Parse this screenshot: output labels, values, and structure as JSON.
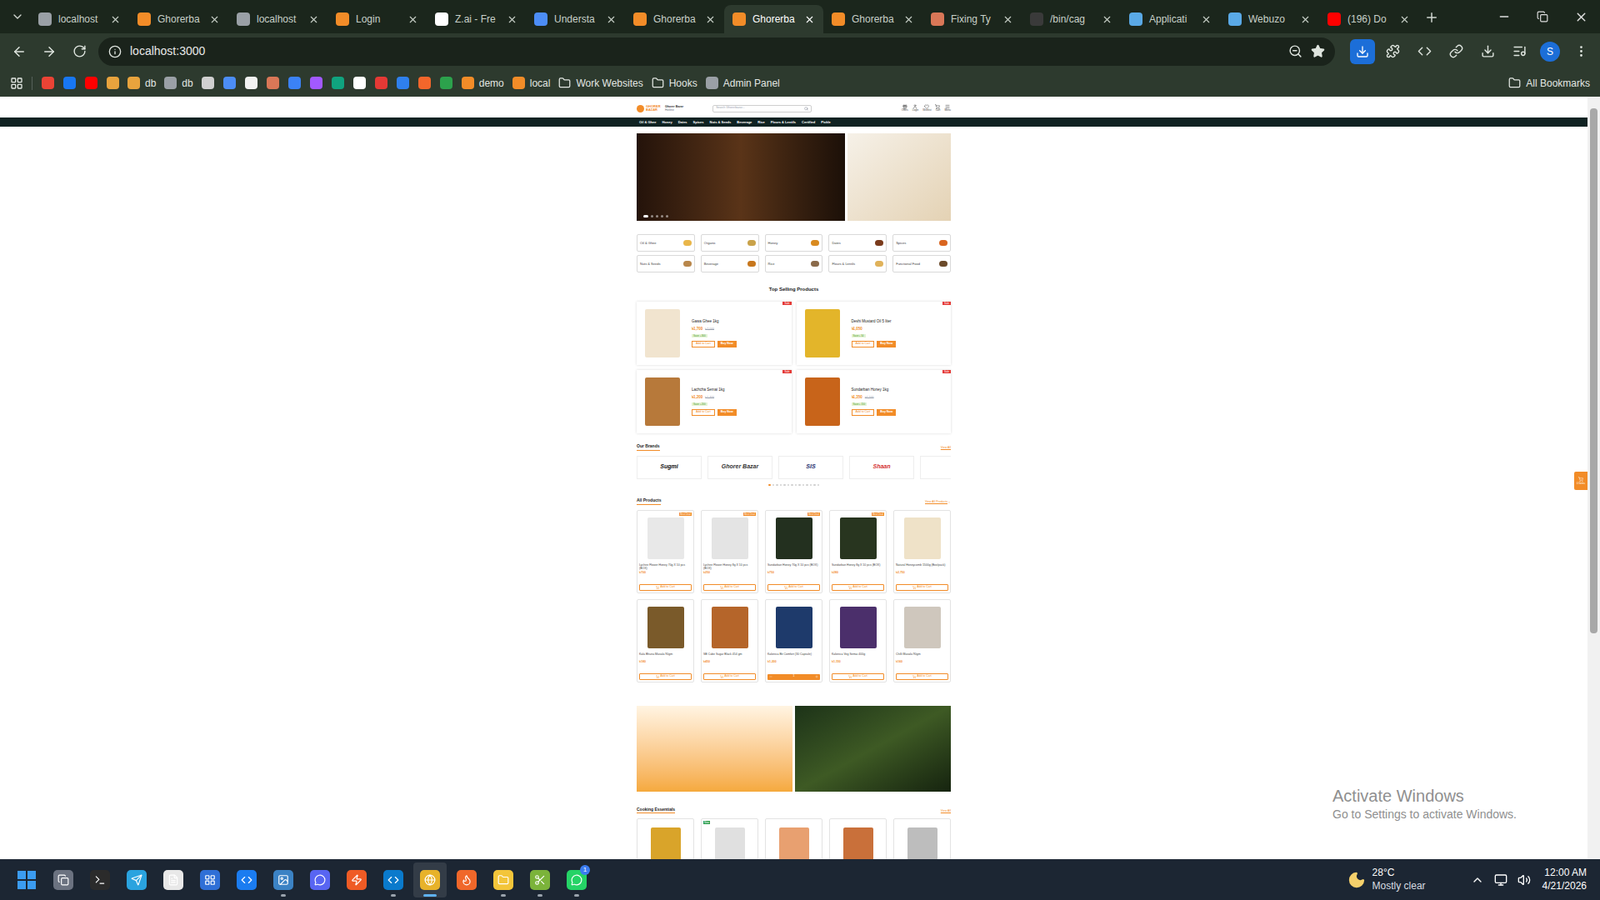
{
  "browser": {
    "tabs": [
      {
        "label": "localhost",
        "selected": false,
        "color": "#9aa0a6"
      },
      {
        "label": "Ghorerba",
        "selected": false,
        "color": "#f28c28"
      },
      {
        "label": "localhost",
        "selected": false,
        "color": "#9aa0a6"
      },
      {
        "label": "Login",
        "selected": false,
        "color": "#f28c28"
      },
      {
        "label": "Z.ai - Fre",
        "selected": false,
        "color": "#ffffff"
      },
      {
        "label": "Understa",
        "selected": false,
        "color": "#4c8df6"
      },
      {
        "label": "Ghorerba",
        "selected": false,
        "color": "#f28c28"
      },
      {
        "label": "Ghorerba",
        "selected": true,
        "color": "#f28c28"
      },
      {
        "label": "Ghorerba",
        "selected": false,
        "color": "#f28c28"
      },
      {
        "label": "Fixing Ty",
        "selected": false,
        "color": "#d97757"
      },
      {
        "label": "/bin/cag",
        "selected": false,
        "color": "#3a3a3a"
      },
      {
        "label": "Applicati",
        "selected": false,
        "color": "#5aa9e6"
      },
      {
        "label": "Webuzo",
        "selected": false,
        "color": "#5aa9e6"
      },
      {
        "label": "(196) Do",
        "selected": false,
        "color": "#ff0000"
      }
    ],
    "address": "localhost:3000",
    "profile": "S",
    "bookmarks": [
      {
        "kind": "icon",
        "color": "#ea4335"
      },
      {
        "kind": "icon",
        "color": "#1877f2"
      },
      {
        "kind": "icon",
        "color": "#ff0000"
      },
      {
        "kind": "icon",
        "color": "#e8a33d"
      },
      {
        "kind": "site",
        "label": "db",
        "color": "#e8a33d"
      },
      {
        "kind": "site",
        "label": "db",
        "color": "#9aa0a6"
      },
      {
        "kind": "icon",
        "color": "#d0d0d0"
      },
      {
        "kind": "icon",
        "color": "#4c8df6"
      },
      {
        "kind": "icon",
        "color": "#f2f2f2"
      },
      {
        "kind": "icon",
        "color": "#d97757"
      },
      {
        "kind": "icon",
        "color": "#3b82f6"
      },
      {
        "kind": "icon",
        "color": "#a259ff"
      },
      {
        "kind": "icon",
        "color": "#10a37f"
      },
      {
        "kind": "icon",
        "color": "#ffffff"
      },
      {
        "kind": "icon",
        "color": "#e53935"
      },
      {
        "kind": "icon",
        "color": "#2f80ed"
      },
      {
        "kind": "icon",
        "color": "#f2662b"
      },
      {
        "kind": "icon",
        "color": "#2ca24c"
      },
      {
        "kind": "site",
        "label": "demo",
        "color": "#f28c28"
      },
      {
        "kind": "site",
        "label": "local",
        "color": "#f28c28"
      },
      {
        "kind": "folder",
        "label": "Work Websites"
      },
      {
        "kind": "folder",
        "label": "Hooks"
      },
      {
        "kind": "site",
        "label": "Admin Panel",
        "color": "#9aa0a6"
      }
    ],
    "all_bookmarks": "All Bookmarks"
  },
  "site": {
    "logo": "GHORER BAZAR",
    "store_name": "Ghorer Bazar",
    "store_sub": "Hotline",
    "search_placeholder": "Search Ghorerbazar...",
    "header_links": [
      "Offers",
      "Login",
      "Wishlist",
      "Cart",
      "Menu"
    ],
    "nav": [
      "Oil & Ghee",
      "Honey",
      "Dates",
      "Spices",
      "Nuts & Seeds",
      "Beverage",
      "Rice",
      "Flours & Lentils",
      "Certified",
      "Pickle"
    ],
    "hero_dots": [
      {
        "selected": true
      },
      {
        "selected": false
      },
      {
        "selected": false
      },
      {
        "selected": false
      },
      {
        "selected": false
      }
    ],
    "categories": [
      {
        "label": "Oil & Ghee",
        "color": "#e9b64a"
      },
      {
        "label": "Organic",
        "color": "#c9a24a"
      },
      {
        "label": "Honey",
        "color": "#d98a1f"
      },
      {
        "label": "Dates",
        "color": "#7a3b1c"
      },
      {
        "label": "Spices",
        "color": "#d9651f"
      },
      {
        "label": "Nuts & Seeds",
        "color": "#b8864a"
      },
      {
        "label": "Beverage",
        "color": "#c7771d"
      },
      {
        "label": "Rice",
        "color": "#8a6a4a"
      },
      {
        "label": "Flours & Lentils",
        "color": "#e0b25a"
      },
      {
        "label": "Functional Food",
        "color": "#6b4a2a"
      }
    ],
    "top_selling": {
      "title": "Top Selling Products",
      "add": "Add to Cart",
      "buy": "Buy Now",
      "products": [
        {
          "name": "Gawa Ghee 1kg",
          "price": "৳1,700",
          "old_price": "৳2,000",
          "save": "Save ৳300",
          "badge": "Sale",
          "color": "#f1e4cf"
        },
        {
          "name": "Deshi Mustard Oil 5 liter",
          "price": "৳1,050",
          "old_price": "",
          "save": "Save ৳50",
          "badge": "Sale",
          "color": "#e3b52a"
        },
        {
          "name": "Lachcha Semai 1kg",
          "price": "৳1,200",
          "old_price": "৳1,400",
          "save": "Save ৳200",
          "badge": "Sale",
          "color": "#b7793a"
        },
        {
          "name": "Sundarban Honey 1kg",
          "price": "৳1,350",
          "old_price": "৳1,500",
          "save": "Save ৳150",
          "badge": "Sale",
          "color": "#c8641a"
        }
      ]
    },
    "brands": {
      "title": "Our Brands",
      "view_all": "View All",
      "items": [
        {
          "name": "Sugmi",
          "color": "#111111"
        },
        {
          "name": "Ghorer Bazar",
          "color": "#333333"
        },
        {
          "name": "SIS",
          "color": "#1a2a6b"
        },
        {
          "name": "Shaan",
          "color": "#d32f2f"
        }
      ],
      "dots": [
        {
          "selected": true
        },
        {
          "selected": false
        },
        {
          "selected": false
        },
        {
          "selected": false
        },
        {
          "selected": false
        },
        {
          "selected": false
        },
        {
          "selected": false
        },
        {
          "selected": false
        },
        {
          "selected": false
        },
        {
          "selected": false
        },
        {
          "selected": false
        },
        {
          "selected": false
        },
        {
          "selected": false
        },
        {
          "selected": false
        }
      ]
    },
    "all_products": {
      "title": "All Products",
      "view_all": "View All Products",
      "add": "Add to Cart",
      "items": [
        {
          "name": "Lychee Flower Honey 70g X 10 pcs (BOX)",
          "price": "৳700",
          "badge": "Best Deal",
          "color": "#e8e8e8",
          "in_cart": false
        },
        {
          "name": "Lychee Flower Honey 8g X 10 pcs (BOX)",
          "price": "৳250",
          "badge": "Best Deal",
          "color": "#e4e4e4",
          "in_cart": false
        },
        {
          "name": "Sundarban Honey 70g X 10 pcs (BOX)",
          "price": "৳750",
          "badge": "Best Deal",
          "color": "#23301f",
          "in_cart": false
        },
        {
          "name": "Sundarban Honey 8g X 10 pcs (BOX)",
          "price": "৳280",
          "badge": "Best Deal",
          "color": "#28351f",
          "in_cart": false
        },
        {
          "name": "Natural Honeycomb 1500g (Box/pack)",
          "price": "৳2,750",
          "badge": "",
          "color": "#efe2c8",
          "in_cart": false
        },
        {
          "name": "Kala Bhuna Masala 90gm",
          "price": "৳180",
          "badge": "",
          "color": "#7a5a2a",
          "in_cart": false
        },
        {
          "name": "SB Cube Sugar Black 454 gm",
          "price": "৳450",
          "badge": "",
          "color": "#b5652a",
          "in_cart": false
        },
        {
          "name": "Kalonica Bit Comfort (30 Capsule)",
          "price": "৳1,200",
          "badge": "",
          "color": "#1e3a6b",
          "in_cart": true,
          "quantity": "1"
        },
        {
          "name": "Kalonica Veg Semai 400g",
          "price": "৳1,150",
          "badge": "",
          "color": "#4b2f6b",
          "in_cart": false
        },
        {
          "name": "Chilli Masala 90gm",
          "price": "৳160",
          "badge": "",
          "color": "#cfc7bd",
          "in_cart": false
        }
      ]
    },
    "cooking": {
      "title": "Cooking Essentials",
      "view_all": "View All",
      "items": [
        {
          "badge": "",
          "color": "#d9a42a"
        },
        {
          "badge": "New",
          "color": "#e0e0e0"
        },
        {
          "badge": "",
          "color": "#e8a070"
        },
        {
          "badge": "",
          "color": "#c9703a"
        },
        {
          "badge": "",
          "color": "#bdbdbd"
        }
      ]
    },
    "cart_widget": "0 Items"
  },
  "watermark": {
    "title": "Activate Windows",
    "subtitle": "Go to Settings to activate Windows."
  },
  "taskbar": {
    "apps": [
      {
        "kind": "start",
        "color": "#3b9cf0",
        "running": false,
        "selected": false
      },
      {
        "kind": "files",
        "color": "#6b7280",
        "running": false,
        "selected": false
      },
      {
        "kind": "terminal",
        "color": "#2b2b2b",
        "running": false,
        "selected": false
      },
      {
        "kind": "telegram",
        "color": "#2aa3df",
        "running": false,
        "selected": false
      },
      {
        "kind": "notepad",
        "color": "#e8e8e8",
        "running": false,
        "selected": false
      },
      {
        "kind": "app",
        "color": "#2f6fd6",
        "running": false,
        "selected": false
      },
      {
        "kind": "webstorm",
        "color": "#1b7cf0",
        "running": false,
        "selected": false
      },
      {
        "kind": "photos",
        "color": "#3b82c4",
        "running": true,
        "selected": false
      },
      {
        "kind": "discord",
        "color": "#5865f2",
        "running": false,
        "selected": false
      },
      {
        "kind": "postman",
        "color": "#ef5b25",
        "running": false,
        "selected": false
      },
      {
        "kind": "vscode",
        "color": "#0a7acc",
        "running": true,
        "selected": false
      },
      {
        "kind": "chrome",
        "color": "#e7b22a",
        "running": true,
        "selected": true
      },
      {
        "kind": "firefox",
        "color": "#f0672a",
        "running": false,
        "selected": false
      },
      {
        "kind": "explorer",
        "color": "#f3c53a",
        "running": true,
        "selected": false
      },
      {
        "kind": "snip",
        "color": "#7bb33a",
        "running": true,
        "selected": false
      },
      {
        "kind": "whatsapp",
        "color": "#25d366",
        "running": true,
        "selected": false,
        "badge": "1"
      }
    ],
    "weather": {
      "temp": "28°C",
      "text": "Mostly clear"
    },
    "time": "12:00 AM",
    "date": "4/21/2026"
  }
}
